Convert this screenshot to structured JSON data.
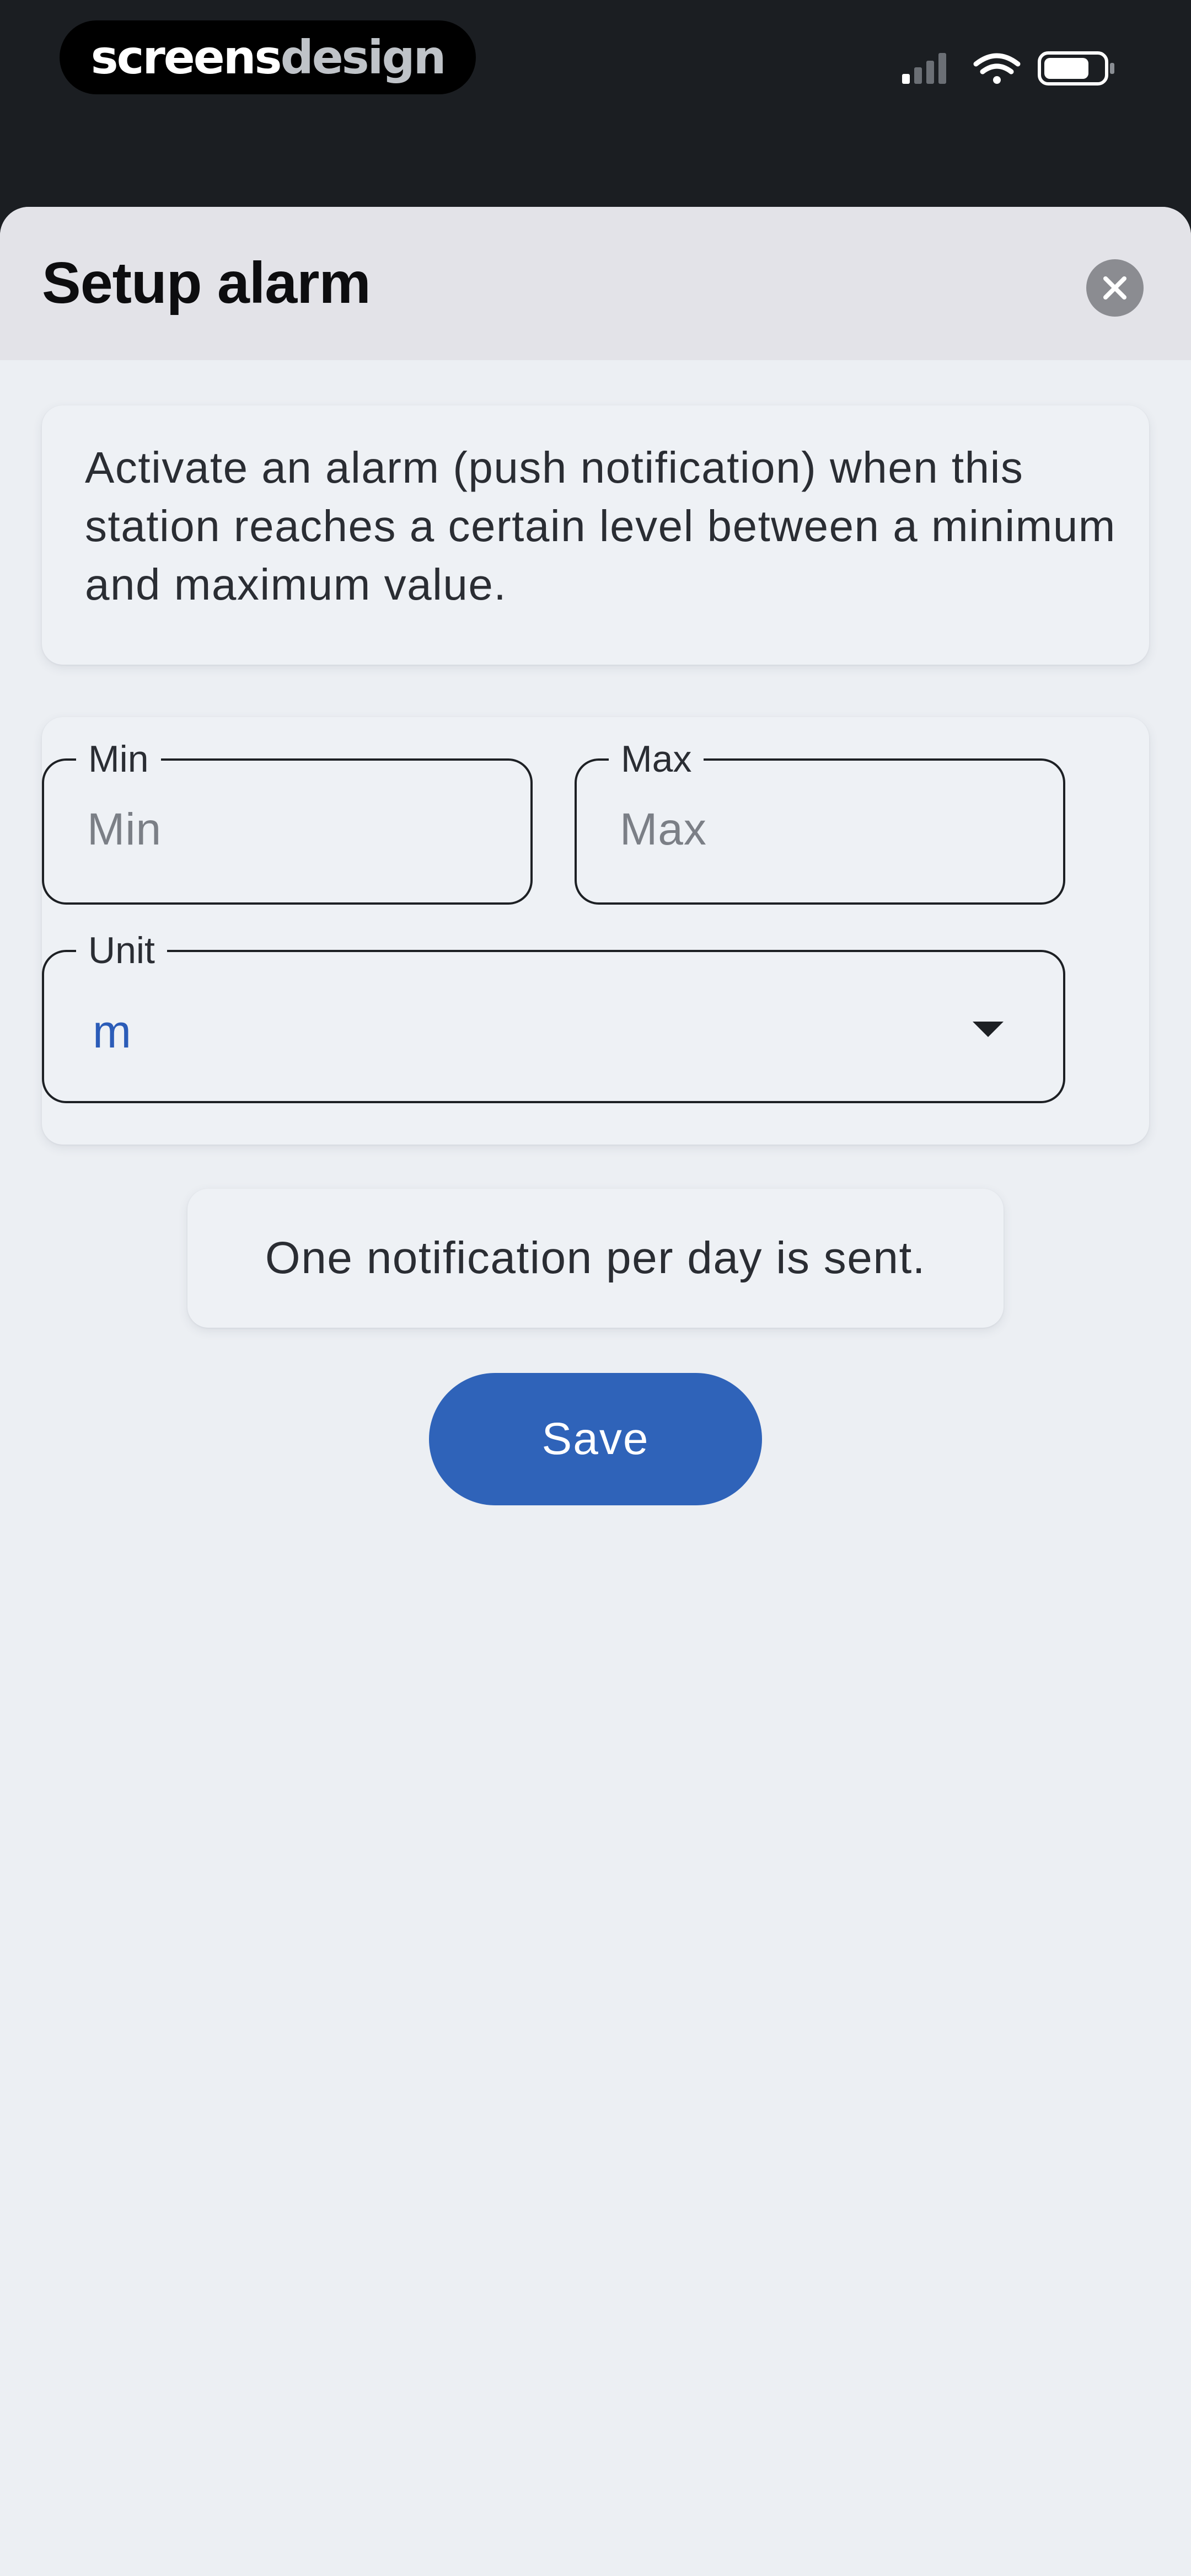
{
  "status_bar": {
    "brand_part_1": "screens",
    "brand_part_2": "design",
    "icons": [
      "cellular-signal-icon",
      "wifi-icon",
      "battery-icon"
    ]
  },
  "sheet": {
    "title": "Setup alarm",
    "close_icon": "close-icon",
    "description": "Activate an alarm (push notification) when this station reaches a certain level between a minimum and maximum value."
  },
  "form": {
    "min": {
      "label": "Min",
      "placeholder": "Min",
      "value": ""
    },
    "max": {
      "label": "Max",
      "placeholder": "Max",
      "value": ""
    },
    "unit": {
      "label": "Unit",
      "selected": "m"
    }
  },
  "note": "One notification per day is sent.",
  "save_label": "Save",
  "colors": {
    "status_bar_bg": "#1b1e22",
    "sheet_bg": "#eceff3",
    "header_bg": "#e3e3e8",
    "primary": "#2f63b9",
    "unit_value": "#2b5cb8"
  }
}
